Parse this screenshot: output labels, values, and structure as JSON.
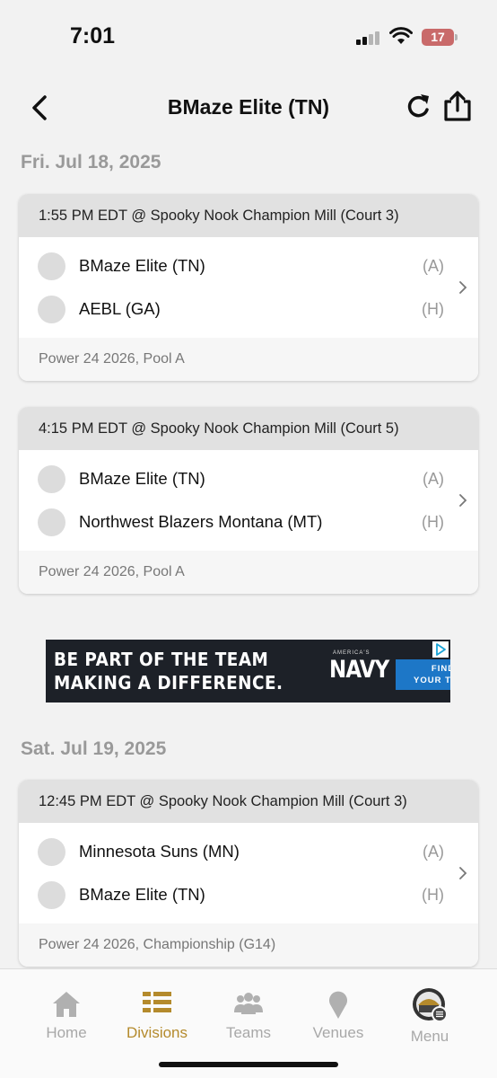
{
  "status_bar": {
    "time": "7:01",
    "battery": "17"
  },
  "header": {
    "title": "BMaze Elite (TN)"
  },
  "days": [
    {
      "date": "Fri. Jul 18, 2025",
      "games": [
        {
          "header": "1:55 PM EDT @ Spooky Nook Champion Mill (Court 3)",
          "teams": [
            {
              "name": "BMaze Elite (TN)",
              "side": "(A)"
            },
            {
              "name": "AEBL (GA)",
              "side": "(H)"
            }
          ],
          "footer": "Power 24 2026, Pool A"
        },
        {
          "header": "4:15 PM EDT @ Spooky Nook Champion Mill (Court 5)",
          "teams": [
            {
              "name": "BMaze Elite (TN)",
              "side": "(A)"
            },
            {
              "name": "Northwest Blazers Montana (MT)",
              "side": "(H)"
            }
          ],
          "footer": "Power 24 2026, Pool A"
        }
      ]
    },
    {
      "date": "Sat. Jul 19, 2025",
      "games": [
        {
          "header": "12:45 PM EDT @ Spooky Nook Champion Mill (Court 3)",
          "teams": [
            {
              "name": "Minnesota Suns (MN)",
              "side": "(A)"
            },
            {
              "name": "BMaze Elite (TN)",
              "side": "(H)"
            }
          ],
          "footer": "Power 24 2026, Championship (G14)"
        }
      ]
    }
  ],
  "ad": {
    "line1": "BE PART OF THE TEAM",
    "line2": "MAKING A DIFFERENCE.",
    "brand_top": "AMERICA'S",
    "brand": "NAVY",
    "cta_line1": "FIND",
    "cta_line2": "YOUR TEAM"
  },
  "tabs": [
    {
      "label": "Home",
      "icon": "home-icon"
    },
    {
      "label": "Divisions",
      "icon": "divisions-icon",
      "active": true
    },
    {
      "label": "Teams",
      "icon": "teams-icon"
    },
    {
      "label": "Venues",
      "icon": "venues-icon"
    },
    {
      "label": "Menu",
      "icon": "menu-icon"
    }
  ],
  "colors": {
    "accent": "#b48a2c",
    "background": "#f2f2f2",
    "card_header": "#e1e1e1",
    "ad_cta": "#1d77c7"
  }
}
